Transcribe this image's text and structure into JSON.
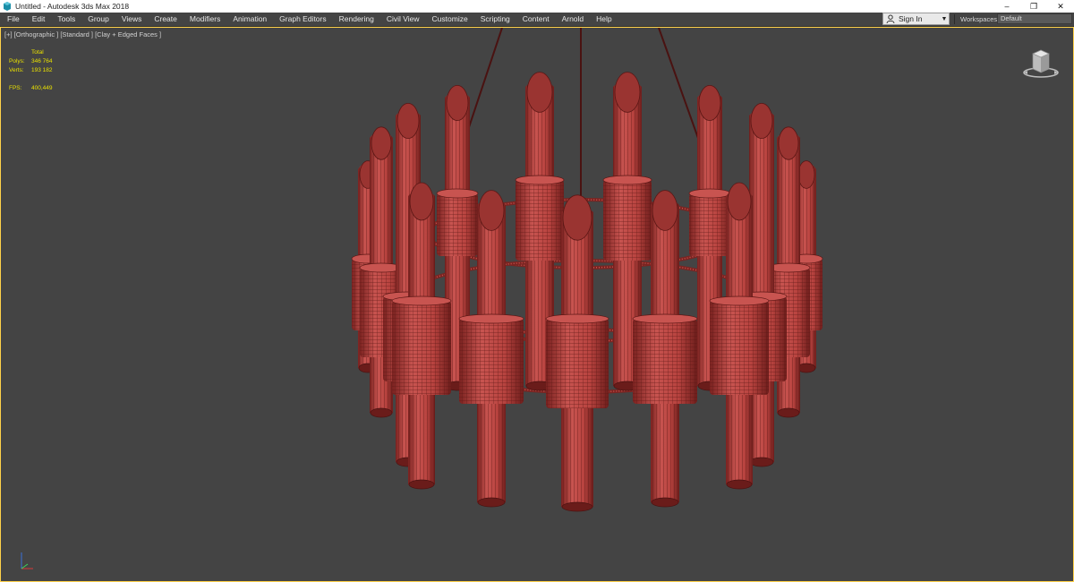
{
  "window": {
    "title": "Untitled - Autodesk 3ds Max 2018",
    "controls": {
      "minimize": "–",
      "restore": "❐",
      "close": "✕"
    }
  },
  "menu": {
    "items": [
      "File",
      "Edit",
      "Tools",
      "Group",
      "Views",
      "Create",
      "Modifiers",
      "Animation",
      "Graph Editors",
      "Rendering",
      "Civil View",
      "Customize",
      "Scripting",
      "Content",
      "Arnold",
      "Help"
    ]
  },
  "account": {
    "sign_in_label": "Sign In",
    "icon": "user-icon"
  },
  "workspaces": {
    "label": "Workspaces:",
    "value": "Default"
  },
  "viewport": {
    "label": "[+] [Orthographic ] [Standard ] [Clay + Edged Faces ]",
    "stats": {
      "header": "Total",
      "polys_label": "Polys:",
      "polys_value": "346 764",
      "verts_label": "Verts:",
      "verts_value": "193 182",
      "fps_label": "FPS:",
      "fps_value": "400,449"
    }
  },
  "colors": {
    "viewport_bg": "#444444",
    "active_border": "#ffd24a",
    "stats_text": "#e9e000",
    "clay_red": "#c24e4a",
    "wire": "#5a1614"
  }
}
